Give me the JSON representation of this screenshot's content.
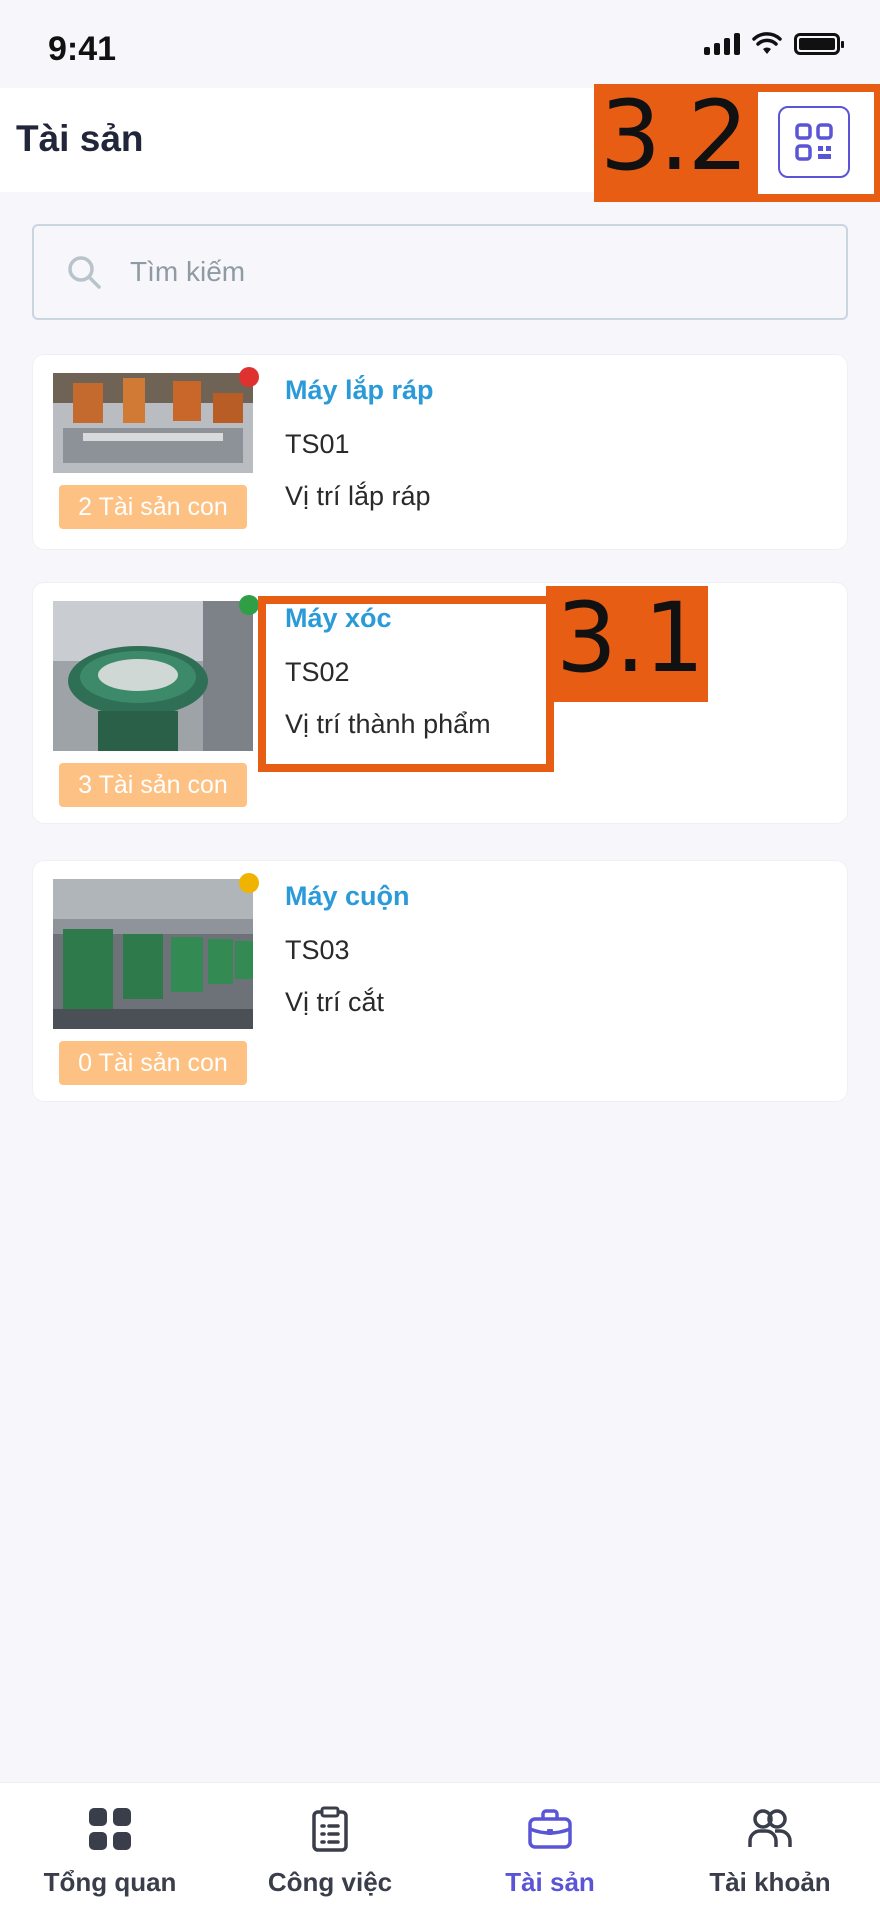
{
  "status_bar": {
    "time": "9:41"
  },
  "header": {
    "title": "Tài sản"
  },
  "annotations": {
    "qr": "3.2",
    "info": "3.1"
  },
  "search": {
    "placeholder": "Tìm kiếm"
  },
  "assets": [
    {
      "name": "Máy lắp ráp",
      "code": "TS01",
      "location": "Vị trí lắp ráp",
      "children": "2 Tài sản con",
      "status_color": "#e03131"
    },
    {
      "name": "Máy xóc",
      "code": "TS02",
      "location": "Vị trí thành phẩm",
      "children": "3 Tài sản con",
      "status_color": "#2f9e44"
    },
    {
      "name": "Máy cuộn",
      "code": "TS03",
      "location": "Vị trí cắt",
      "children": "0 Tài sản con",
      "status_color": "#f0b400"
    }
  ],
  "tabs": [
    {
      "label": "Tổng quan",
      "icon": "grid-icon"
    },
    {
      "label": "Công việc",
      "icon": "clipboard-icon"
    },
    {
      "label": "Tài sản",
      "icon": "briefcase-icon",
      "active": true
    },
    {
      "label": "Tài khoản",
      "icon": "users-icon"
    }
  ],
  "colors": {
    "accent": "#5a55d6",
    "link": "#2b9ad8",
    "badge": "#fcc183",
    "annotation": "#e85d14"
  }
}
